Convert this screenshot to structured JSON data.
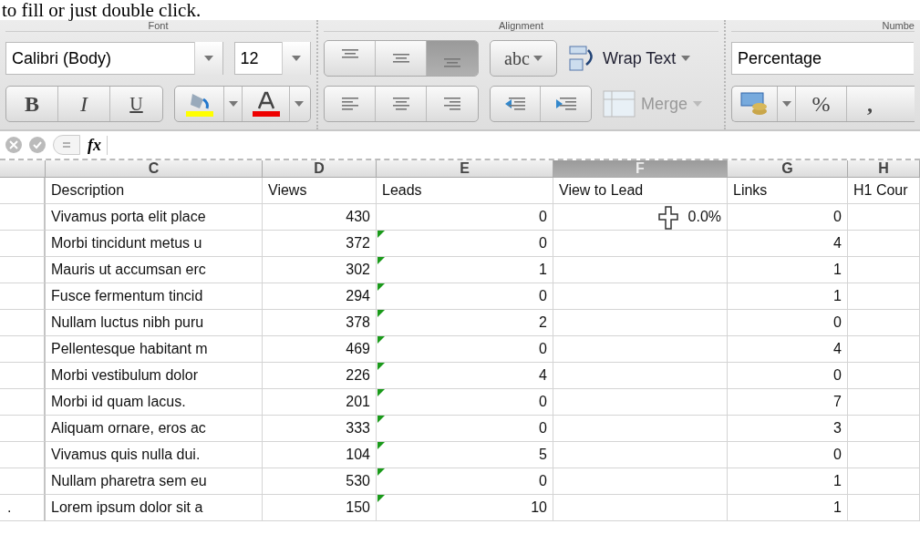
{
  "caption": "to fill or just double click.",
  "font": {
    "group_label": "Font",
    "family": "Calibri (Body)",
    "size": "12",
    "bold_label": "B",
    "italic_label": "I",
    "underline_label": "U"
  },
  "alignment": {
    "group_label": "Alignment",
    "vertical": [
      {
        "selected": false
      },
      {
        "selected": false
      },
      {
        "selected": true
      }
    ],
    "orientation_label": "abc",
    "wrap_label": "Wrap Text",
    "merge": {
      "label": "Merge",
      "disabled": true
    }
  },
  "number": {
    "group_label": "Numbe",
    "format": "Percentage",
    "percent_label": "%",
    "comma_label": ","
  },
  "formula_bar": {
    "fx": "fx"
  },
  "sheet": {
    "columns": [
      {
        "letter": "C",
        "selected": false
      },
      {
        "letter": "D",
        "selected": false
      },
      {
        "letter": "E",
        "selected": false
      },
      {
        "letter": "F",
        "selected": true
      },
      {
        "letter": "G",
        "selected": false
      },
      {
        "letter": "H",
        "selected": false
      }
    ],
    "rows": [
      {
        "kind": "header",
        "c": "Description",
        "d": "Views",
        "e": "Leads",
        "f": "View to Lead",
        "g": "Links",
        "h": "H1 Cour"
      },
      {
        "kind": "data",
        "c": "Vivamus porta elit place",
        "d": "430",
        "e": "0",
        "f": "0.0%",
        "g": "0",
        "error_flag": false
      },
      {
        "kind": "data",
        "c": "Morbi tincidunt metus u",
        "d": "372",
        "e": "0",
        "g": "4",
        "error_flag": true
      },
      {
        "kind": "data",
        "c": "Mauris ut accumsan erc",
        "d": "302",
        "e": "1",
        "g": "1",
        "error_flag": true
      },
      {
        "kind": "data",
        "c": "Fusce fermentum tincid",
        "d": "294",
        "e": "0",
        "g": "1",
        "error_flag": true
      },
      {
        "kind": "data",
        "c": "Nullam luctus nibh puru",
        "d": "378",
        "e": "2",
        "g": "0",
        "error_flag": true
      },
      {
        "kind": "data",
        "c": "Pellentesque habitant m",
        "d": "469",
        "e": "0",
        "g": "4",
        "error_flag": true
      },
      {
        "kind": "data",
        "c": "Morbi vestibulum dolor",
        "d": "226",
        "e": "4",
        "g": "0",
        "error_flag": true
      },
      {
        "kind": "data",
        "c": "Morbi id quam lacus.",
        "d": "201",
        "e": "0",
        "g": "7",
        "error_flag": true
      },
      {
        "kind": "data",
        "c": "Aliquam ornare, eros ac",
        "d": "333",
        "e": "0",
        "g": "3",
        "error_flag": true
      },
      {
        "kind": "data",
        "c": "Vivamus quis nulla dui.",
        "d": "104",
        "e": "5",
        "g": "0",
        "error_flag": true
      },
      {
        "kind": "data",
        "c": "Nullam pharetra sem eu",
        "d": "530",
        "e": "0",
        "g": "1",
        "error_flag": true
      },
      {
        "kind": "data",
        "b": ".",
        "c": "Lorem ipsum dolor sit a",
        "d": "150",
        "e": "10",
        "g": "1",
        "error_flag": true
      }
    ]
  }
}
